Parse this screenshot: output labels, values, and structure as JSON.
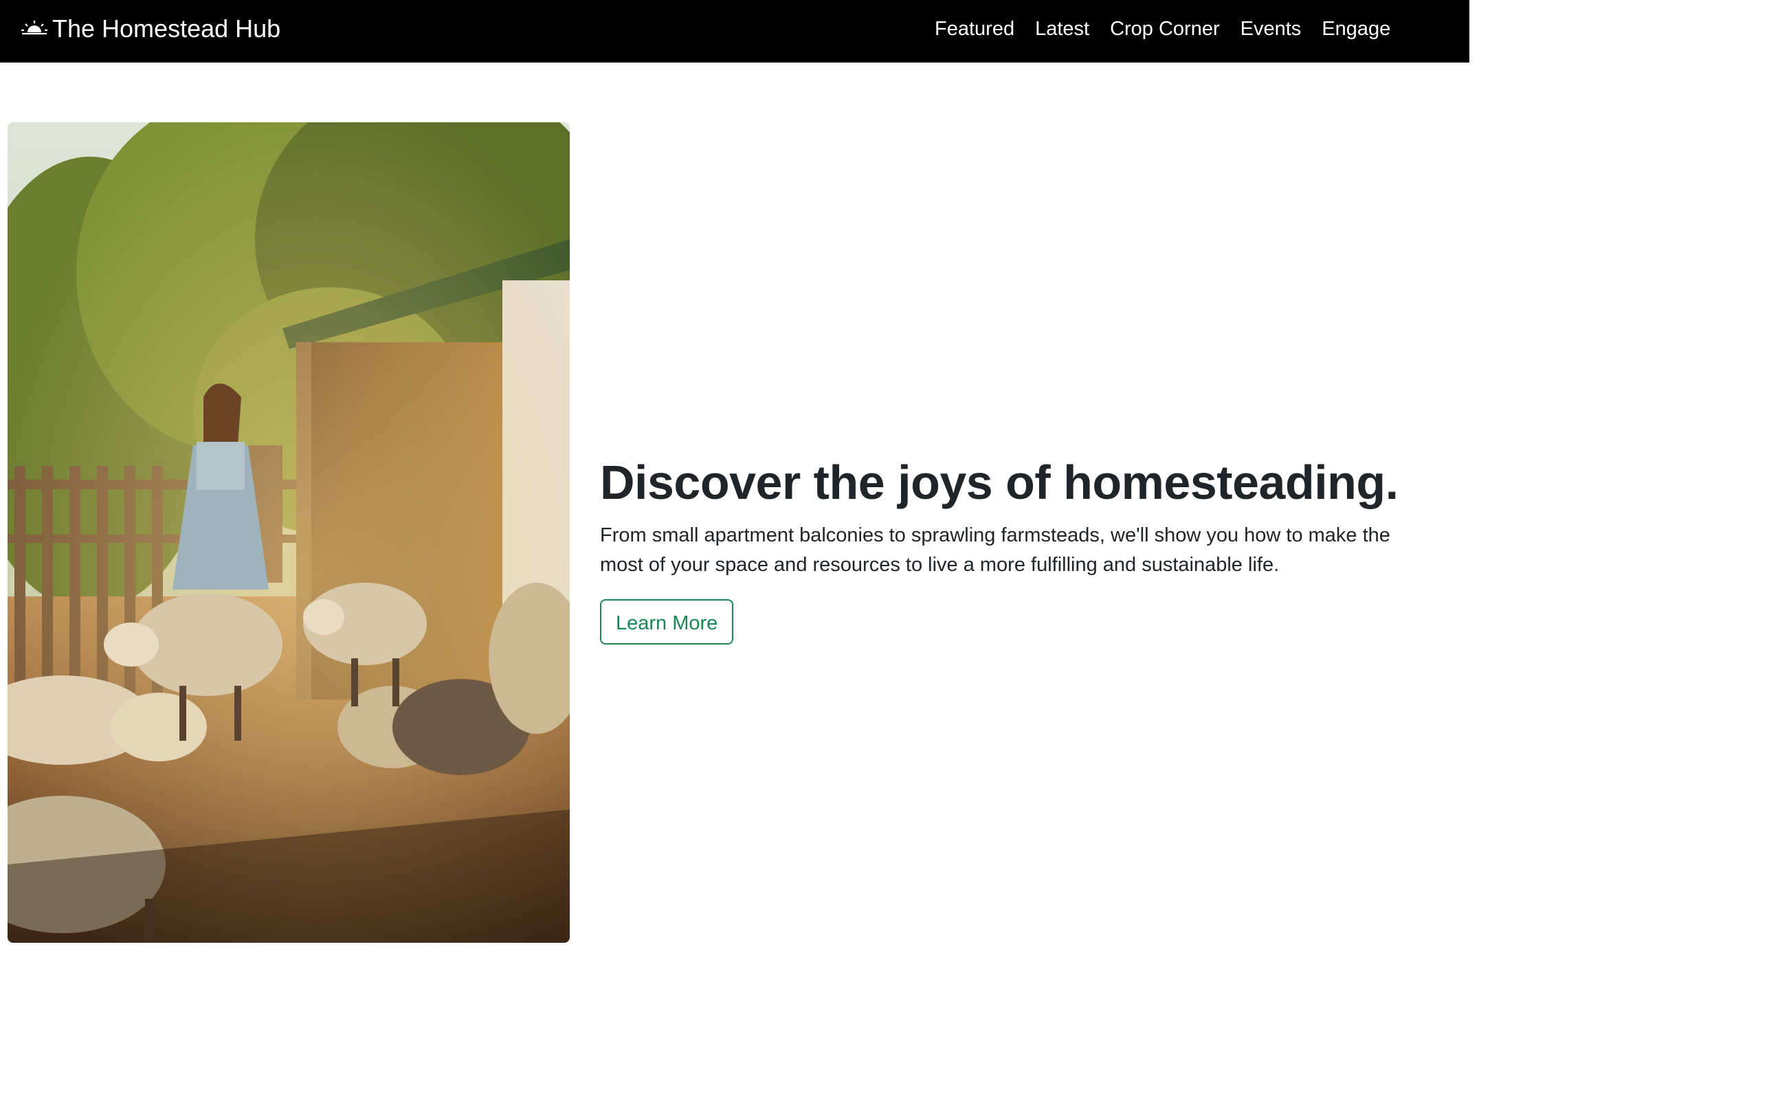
{
  "colors": {
    "navbar_bg": "#000000",
    "nav_text": "#ffffff",
    "heading_text": "#212529",
    "accent_green": "#198754",
    "page_bg": "#ffffff"
  },
  "navbar": {
    "brand_icon": "sunrise-icon",
    "brand_label": "The Homestead Hub",
    "links": [
      {
        "label": "Featured"
      },
      {
        "label": "Latest"
      },
      {
        "label": "Crop Corner"
      },
      {
        "label": "Events"
      },
      {
        "label": "Engage"
      }
    ]
  },
  "hero": {
    "image_alt": "Woman running with sheep beside a wooden barn",
    "title": "Discover the joys of homesteading.",
    "lead": "From small apartment balconies to sprawling farmsteads, we'll show you how to make the most of your space and resources to live a more fulfilling and sustainable life.",
    "button_label": "Learn More"
  }
}
